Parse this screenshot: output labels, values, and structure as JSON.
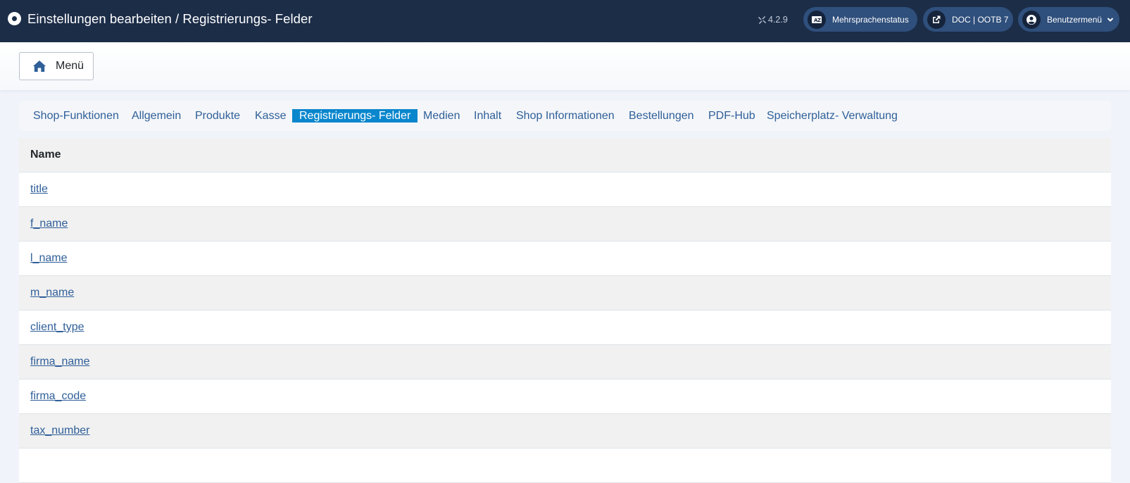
{
  "header": {
    "title": "Einstellungen bearbeiten / Registrierungs- Felder",
    "version": "4.2.9",
    "language_status": "Mehrsprachenstatus",
    "doc_link": "DOC | OOTB 7",
    "user_menu": "Benutzermenü"
  },
  "toolbar": {
    "menu_label": "Menü"
  },
  "tabs": [
    "Shop-Funktionen",
    "Allgemein",
    "Produkte",
    "Kasse",
    "Registrierungs- Felder",
    "Medien",
    "Inhalt",
    "Shop Informationen",
    "Bestellungen",
    "PDF-Hub",
    "Speicherplatz- Verwaltung"
  ],
  "active_tab": "Registrierungs- Felder",
  "table": {
    "header": "Name",
    "rows": [
      "title",
      "f_name",
      "l_name",
      "m_name",
      "client_type",
      "firma_name",
      "firma_code",
      "tax_number"
    ]
  },
  "colors": {
    "header_bg": "#1c2d48",
    "pill_bg": "#2f4f7c",
    "active_tab_bg": "#0a86cd",
    "link": "#2f5f99"
  }
}
